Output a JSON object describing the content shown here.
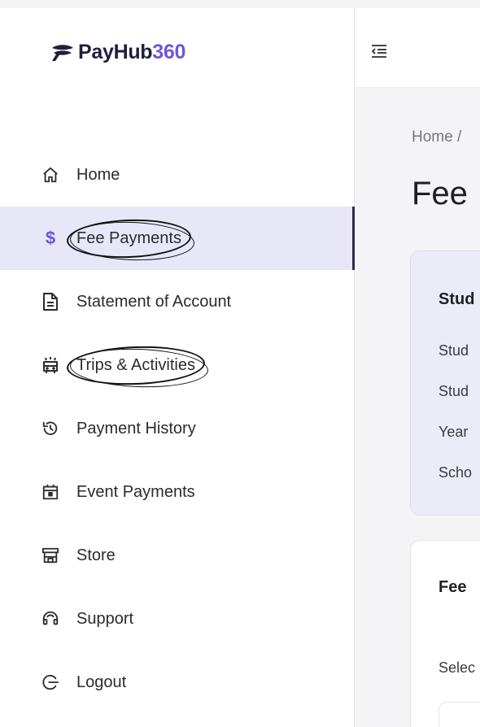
{
  "brand": {
    "name_part1": "PayHub",
    "name_part2": "360",
    "accent": "#6f56d9",
    "dark": "#1f1f3d"
  },
  "sidebar": {
    "items": [
      {
        "label": "Home",
        "icon": "home-icon"
      },
      {
        "label": "Fee Payments",
        "icon": "dollar-icon",
        "active": true
      },
      {
        "label": "Statement of Account",
        "icon": "document-icon"
      },
      {
        "label": "Trips & Activities",
        "icon": "bus-icon"
      },
      {
        "label": "Payment History",
        "icon": "history-icon"
      },
      {
        "label": "Event Payments",
        "icon": "calendar-icon"
      },
      {
        "label": "Store",
        "icon": "store-icon"
      },
      {
        "label": "Support",
        "icon": "headset-icon"
      },
      {
        "label": "Logout",
        "icon": "logout-icon"
      }
    ]
  },
  "header": {
    "menu_icon": "menu-collapse-icon"
  },
  "main": {
    "breadcrumb": "Home /",
    "title": "Fee",
    "student_card": {
      "title": "Stud",
      "rows": [
        "Stud",
        "Stud",
        "Year",
        "Scho"
      ]
    },
    "fee_card": {
      "title": "Fee",
      "select_label": "Selec"
    }
  }
}
